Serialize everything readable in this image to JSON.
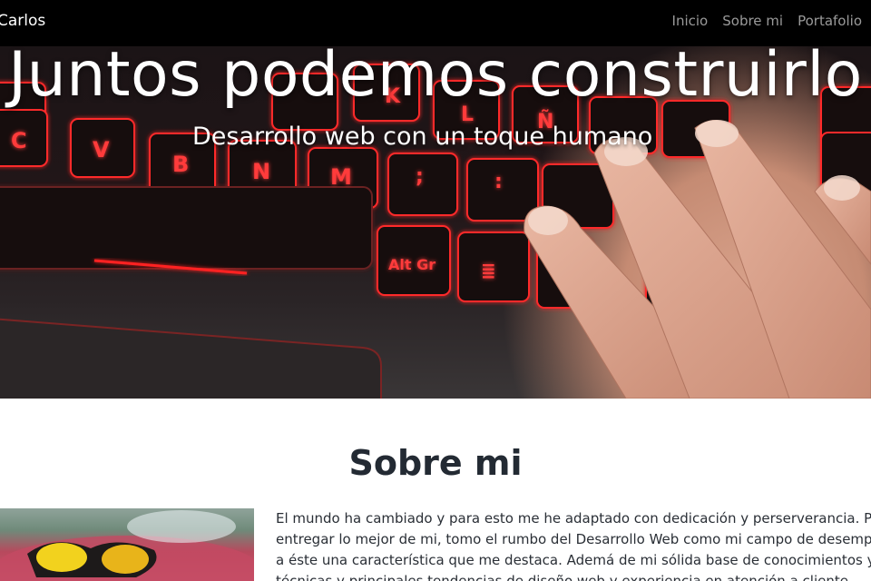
{
  "navbar": {
    "brand": "Carlos",
    "links": [
      {
        "label": "Inicio"
      },
      {
        "label": "Sobre mi"
      },
      {
        "label": "Portafolio"
      }
    ]
  },
  "hero": {
    "title": "Juntos podemos construirlo",
    "subtitle": "Desarrollo web con un toque humano",
    "keys": [
      "C",
      "V",
      "B",
      "N",
      "M",
      "K",
      "L",
      "Ñ",
      ";",
      ":",
      "Alt Gr",
      "≣"
    ]
  },
  "about": {
    "heading": "Sobre mi",
    "lines": [
      "El mundo ha cambiado y para esto me he adaptado con dedicación y perserverancia. Par",
      "entregar lo mejor de mi, tomo el rumbo del Desarrollo Web como mi campo de desempeño",
      "a éste una característica que me destaca. Ademá de mi sólida base de conocimientos y con",
      "técnicas y principales tendencias de diseño web y experiencia en atención a cliente"
    ]
  },
  "colors": {
    "navbar_bg": "#000000",
    "heading_color": "#232a33",
    "key_glow": "#ff2020"
  }
}
